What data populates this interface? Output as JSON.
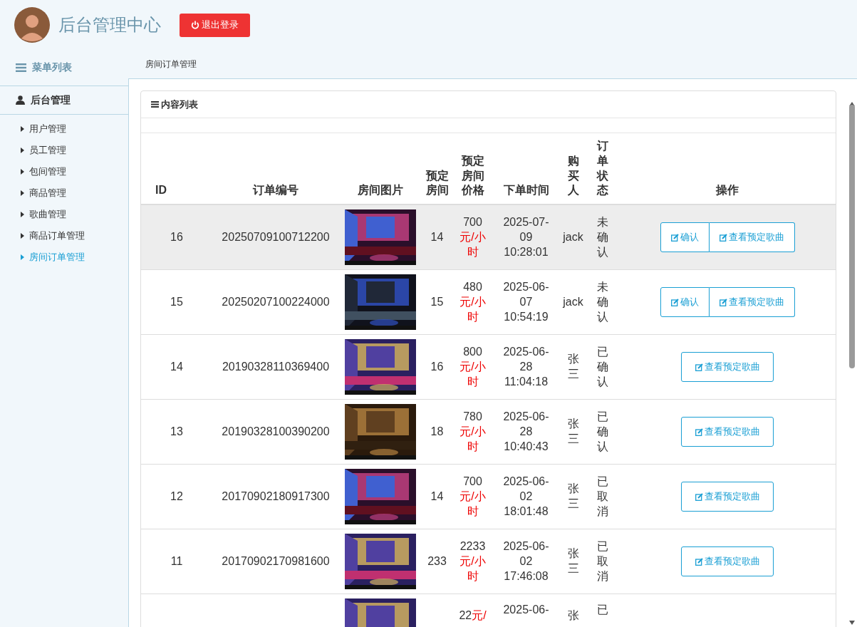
{
  "header": {
    "title": "后台管理中心",
    "logout_button": "退出登录"
  },
  "sidebar": {
    "menu_title": "菜单列表",
    "section": "后台管理",
    "items": [
      {
        "label": "用户管理",
        "selected": false
      },
      {
        "label": "员工管理",
        "selected": false
      },
      {
        "label": "包间管理",
        "selected": false
      },
      {
        "label": "商品管理",
        "selected": false
      },
      {
        "label": "歌曲管理",
        "selected": false
      },
      {
        "label": "商品订单管理",
        "selected": false
      },
      {
        "label": "房间订单管理",
        "selected": true
      }
    ]
  },
  "breadcrumb": "房间订单管理",
  "panel": {
    "title": "内容列表"
  },
  "table": {
    "columns": [
      "ID",
      "订单编号",
      "房间图片",
      "预定房间",
      "预定房间价格",
      "下单时间",
      "购买人",
      "订单状态",
      "操作"
    ],
    "rows": [
      {
        "kind": "full",
        "hovered": true,
        "id": "16",
        "order_no": "20250709100712200",
        "room": "14",
        "price": "700",
        "unit": "元/小时",
        "time": "2025-07-09 10:28:01",
        "buyer": "jack",
        "status": "未确认",
        "actions": [
          "确认",
          "查看预定歌曲"
        ]
      },
      {
        "kind": "full",
        "hovered": false,
        "id": "15",
        "order_no": "20250207100224000",
        "room": "15",
        "price": "480",
        "unit": "元/小时",
        "time": "2025-06-07 10:54:19",
        "buyer": "jack",
        "status": "未确认",
        "actions": [
          "确认",
          "查看预定歌曲"
        ]
      },
      {
        "kind": "full",
        "hovered": false,
        "id": "14",
        "order_no": "20190328110369400",
        "room": "16",
        "price": "800",
        "unit": "元/小时",
        "time": "2025-06-28 11:04:18",
        "buyer": "张三",
        "status": "已确认",
        "actions": [
          "查看预定歌曲"
        ]
      },
      {
        "kind": "full",
        "hovered": false,
        "id": "13",
        "order_no": "20190328100390200",
        "room": "18",
        "price": "780",
        "unit": "元/小时",
        "time": "2025-06-28 10:40:43",
        "buyer": "张三",
        "status": "已确认",
        "actions": [
          "查看预定歌曲"
        ]
      },
      {
        "kind": "full",
        "hovered": false,
        "id": "12",
        "order_no": "20170902180917300",
        "room": "14",
        "price": "700",
        "unit": "元/小时",
        "time": "2025-06-02 18:01:48",
        "buyer": "张三",
        "status": "已取消",
        "actions": [
          "查看预定歌曲"
        ]
      },
      {
        "kind": "full",
        "hovered": false,
        "id": "11",
        "order_no": "20170902170981600",
        "room": "233",
        "price": "2233",
        "unit": "元/小时",
        "time": "2025-06-02 17:46:08",
        "buyer": "张三",
        "status": "已取消",
        "actions": [
          "查看预定歌曲"
        ]
      },
      {
        "kind": "partial",
        "price": "22",
        "unit": "元/",
        "time": "2025-06-",
        "buyer": "张",
        "status": "已"
      }
    ]
  }
}
